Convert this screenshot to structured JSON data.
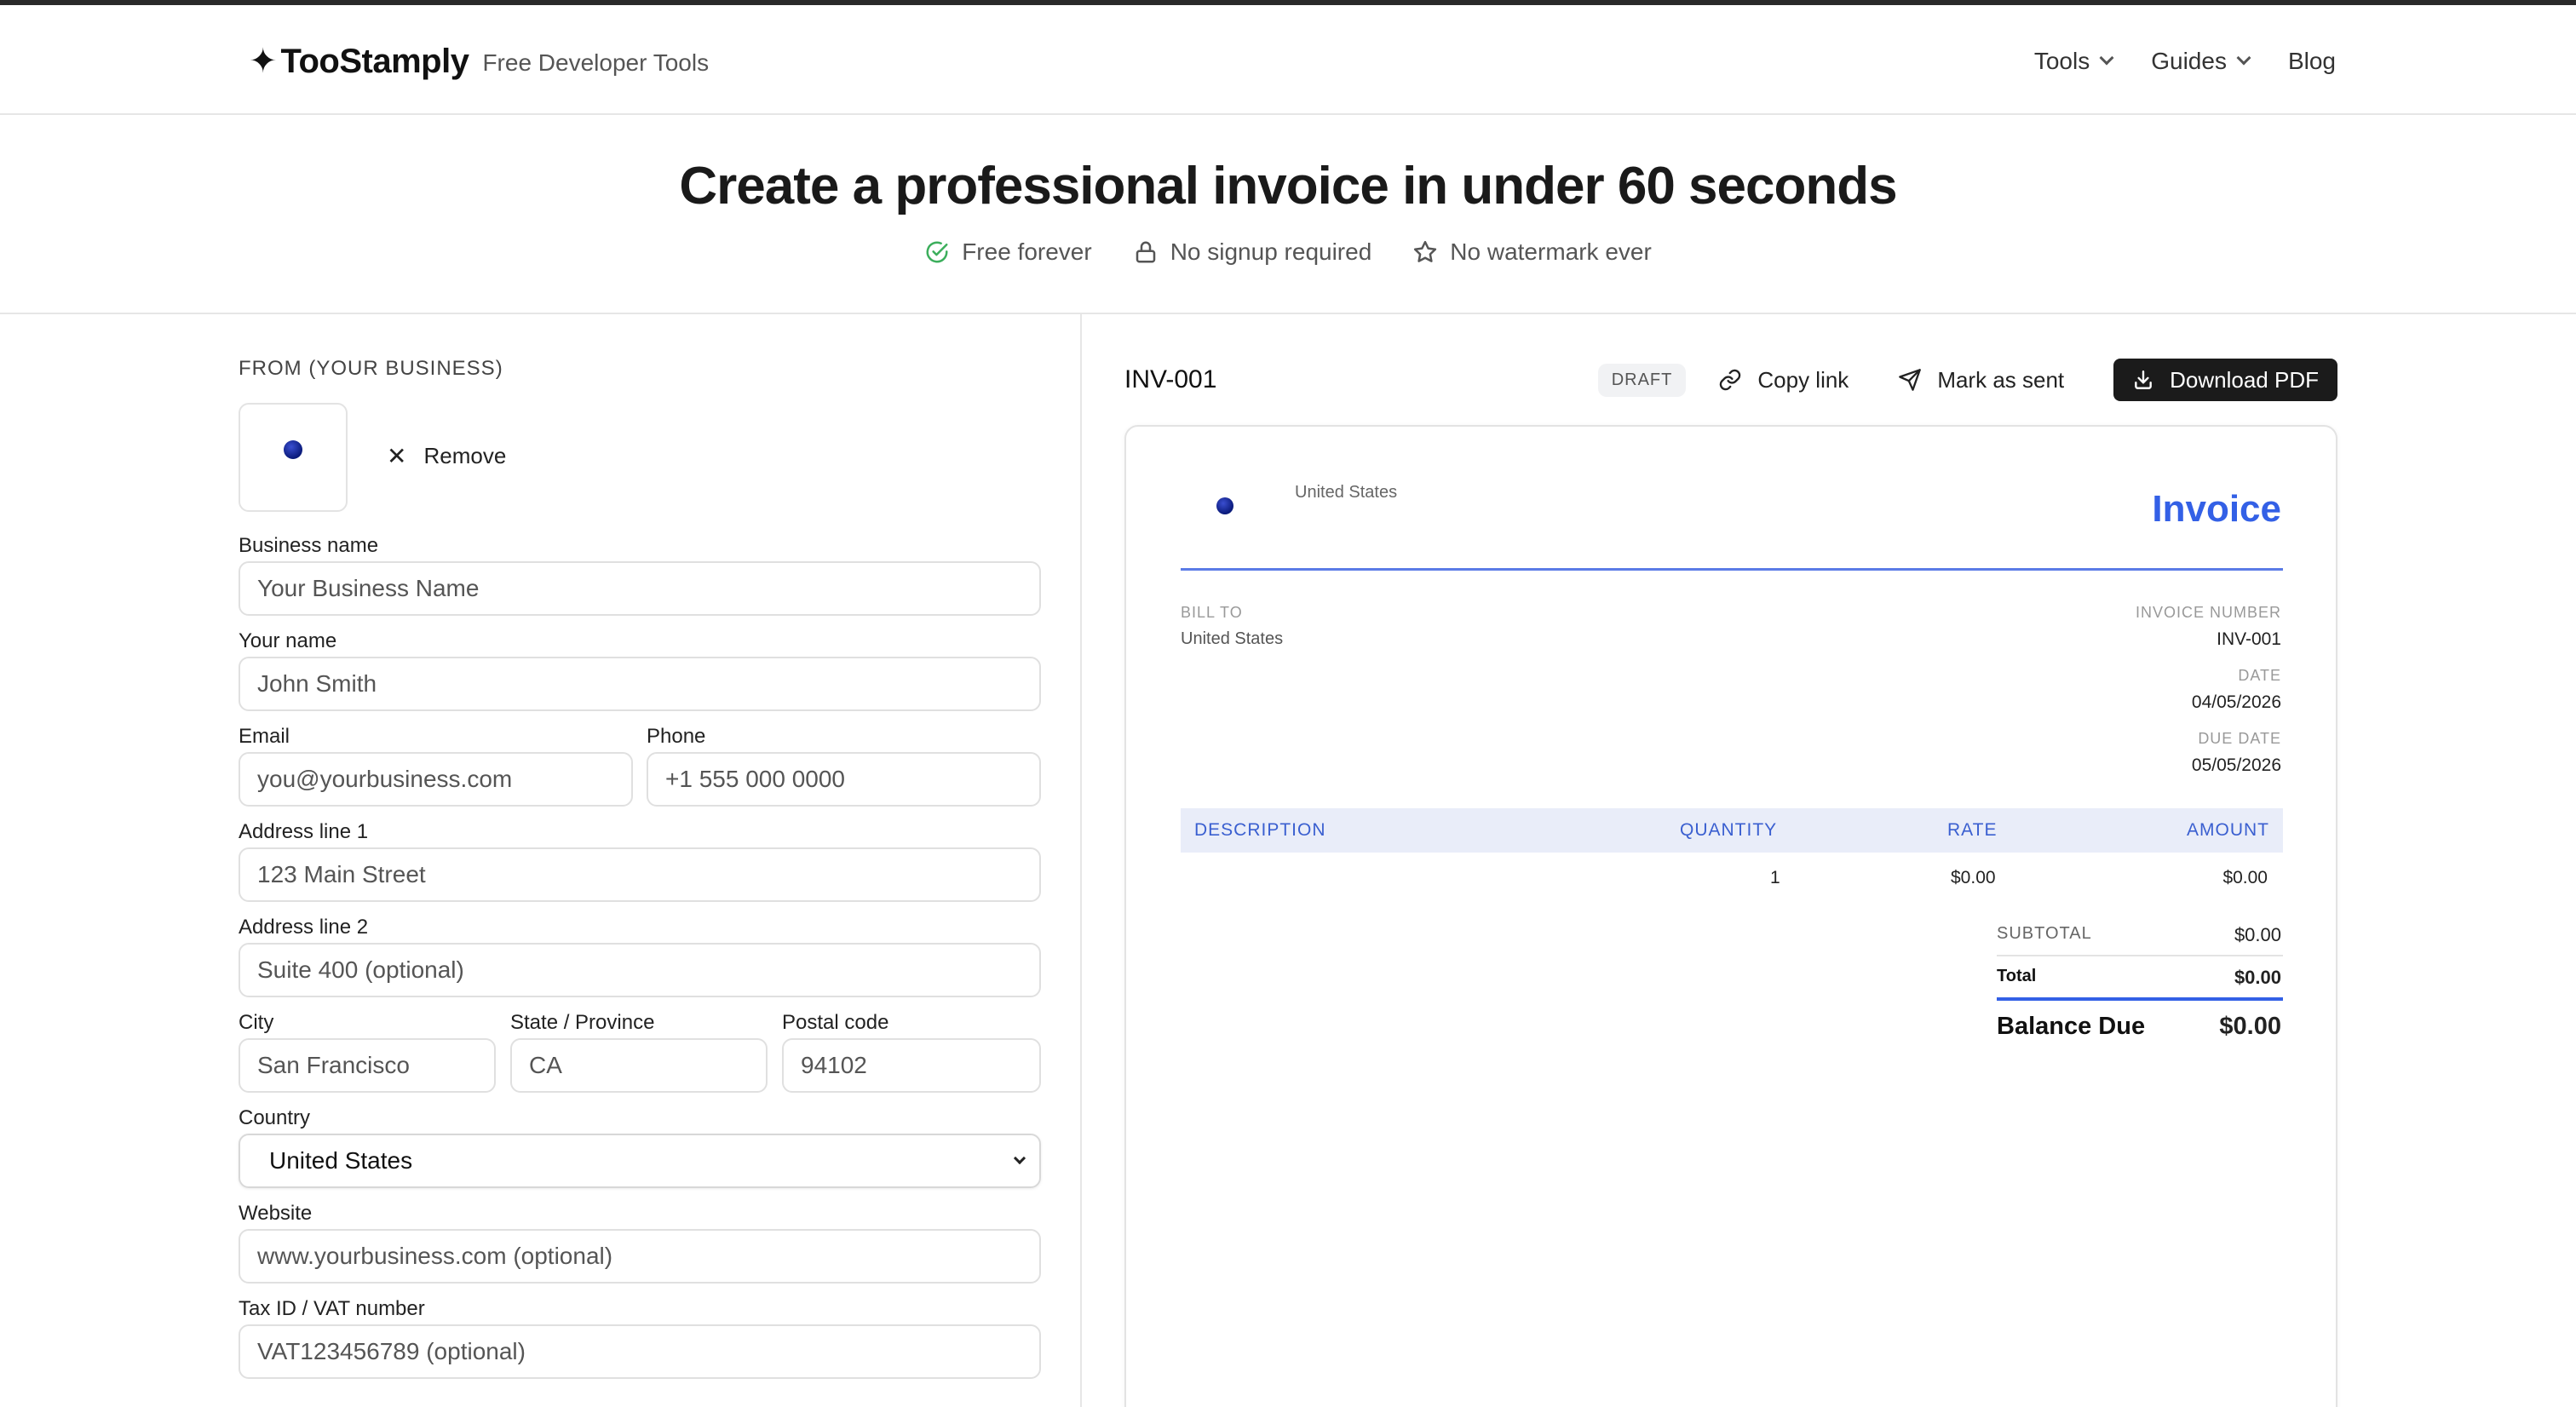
{
  "header": {
    "brand_star": "✦",
    "brand_name": "TooStamply",
    "brand_tag": "Free Developer Tools",
    "nav": [
      {
        "label": "Tools"
      },
      {
        "label": "Guides"
      },
      {
        "label": "Blog"
      }
    ]
  },
  "hero": {
    "title": "Create a professional invoice in under 60 seconds",
    "badges": [
      {
        "label": "Free forever",
        "icon": "check-circle-icon"
      },
      {
        "label": "No signup required",
        "icon": "lock-icon"
      },
      {
        "label": "No watermark ever",
        "icon": "star-icon"
      }
    ]
  },
  "form": {
    "section_title": "FROM (YOUR BUSINESS)",
    "remove_label": "Remove",
    "fields": {
      "business_name": {
        "label": "Business name",
        "placeholder": "Your Business Name"
      },
      "your_name": {
        "label": "Your name",
        "placeholder": "John Smith"
      },
      "email": {
        "label": "Email",
        "placeholder": "you@yourbusiness.com"
      },
      "phone": {
        "label": "Phone",
        "placeholder": "+1 555 000 0000"
      },
      "address1": {
        "label": "Address line 1",
        "placeholder": "123 Main Street"
      },
      "address2": {
        "label": "Address line 2",
        "placeholder": "Suite 400 (optional)"
      },
      "city": {
        "label": "City",
        "placeholder": "San Francisco"
      },
      "state": {
        "label": "State / Province",
        "placeholder": "CA"
      },
      "postal": {
        "label": "Postal code",
        "placeholder": "94102"
      },
      "country": {
        "label": "Country",
        "value": "United States"
      },
      "website": {
        "label": "Website",
        "placeholder": "www.yourbusiness.com (optional)"
      },
      "tax_id": {
        "label": "Tax ID / VAT number",
        "placeholder": "VAT123456789 (optional)"
      }
    }
  },
  "preview": {
    "invoice_id": "INV-001",
    "status_badge": "DRAFT",
    "copy_link": "Copy link",
    "mark_sent": "Mark as sent",
    "download": "Download PDF",
    "paper": {
      "from_country": "United States",
      "title": "Invoice",
      "bill_to_label": "BILL TO",
      "bill_to_value": "United States",
      "invoice_number_label": "INVOICE NUMBER",
      "invoice_number": "INV-001",
      "date_label": "DATE",
      "date": "04/05/2026",
      "due_date_label": "DUE DATE",
      "due_date": "05/05/2026",
      "columns": [
        "DESCRIPTION",
        "QUANTITY",
        "RATE",
        "AMOUNT"
      ],
      "row": {
        "quantity": "1",
        "rate": "$0.00",
        "amount": "$0.00"
      },
      "subtotal_label": "SUBTOTAL",
      "subtotal": "$0.00",
      "total_label": "Total",
      "total": "$0.00",
      "balance_label": "Balance Due",
      "balance": "$0.00"
    }
  },
  "colors": {
    "accent": "#3360e6",
    "success": "#3cae5c"
  }
}
